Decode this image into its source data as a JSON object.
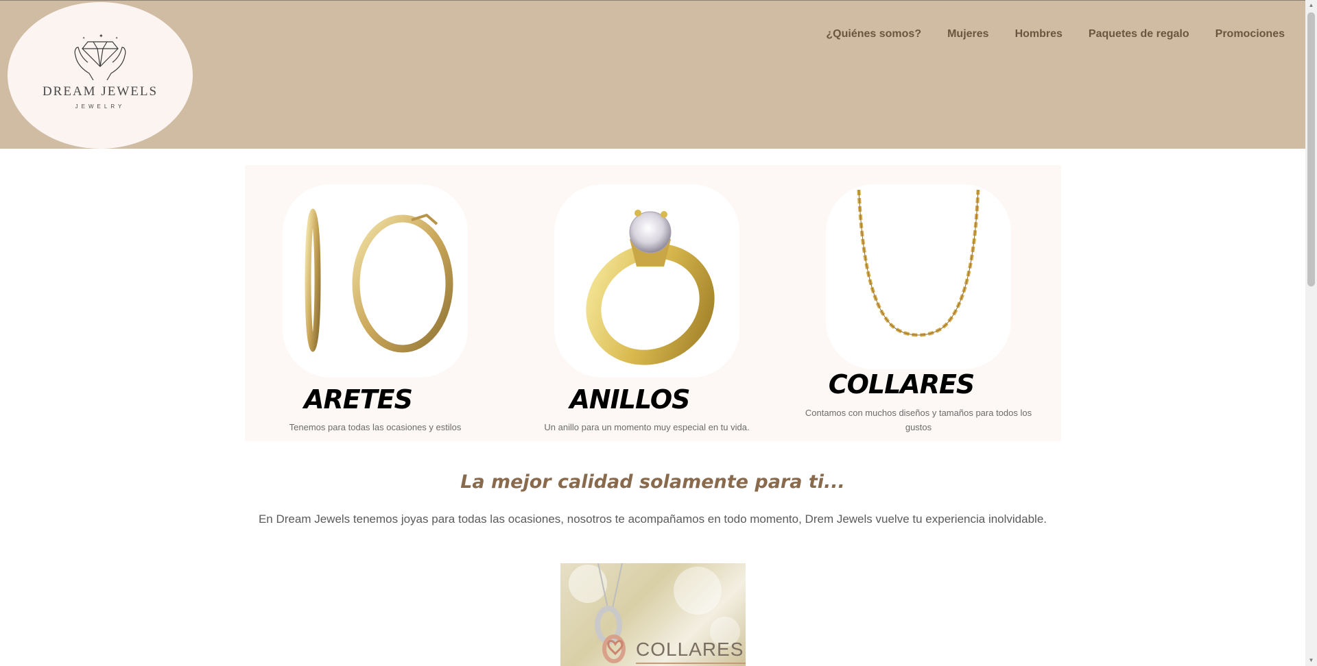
{
  "brand": {
    "name": "DREAM JEWELS",
    "tagline": "JEWELRY"
  },
  "nav": {
    "items": [
      {
        "label": "¿Quiénes somos?"
      },
      {
        "label": "Mujeres"
      },
      {
        "label": "Hombres"
      },
      {
        "label": "Paquetes de regalo"
      },
      {
        "label": "Promociones"
      }
    ]
  },
  "categories": [
    {
      "title": "ARETES",
      "description": "Tenemos para todas las ocasiones y estilos",
      "icon": "earrings-image"
    },
    {
      "title": "ANILLOS",
      "description": "Un anillo para un momento muy especial en tu vida.",
      "icon": "ring-image"
    },
    {
      "title": "COLLARES",
      "description": "Contamos con muchos diseños y tamaños para todos los gustos",
      "icon": "necklace-image"
    }
  ],
  "section": {
    "headline": "La mejor calidad solamente para ti...",
    "lead": "En Dream Jewels tenemos joyas para todas las ocasiones, nosotros te acompañamos en todo momento, Drem Jewels vuelve tu experiencia inolvidable."
  },
  "promo": {
    "label": "COLLARES"
  },
  "colors": {
    "header": "#cfbca3",
    "nav_text": "#6b5540",
    "headline": "#8a6a4d",
    "panel": "#fdf8f5",
    "gold": "#d4b25a"
  }
}
